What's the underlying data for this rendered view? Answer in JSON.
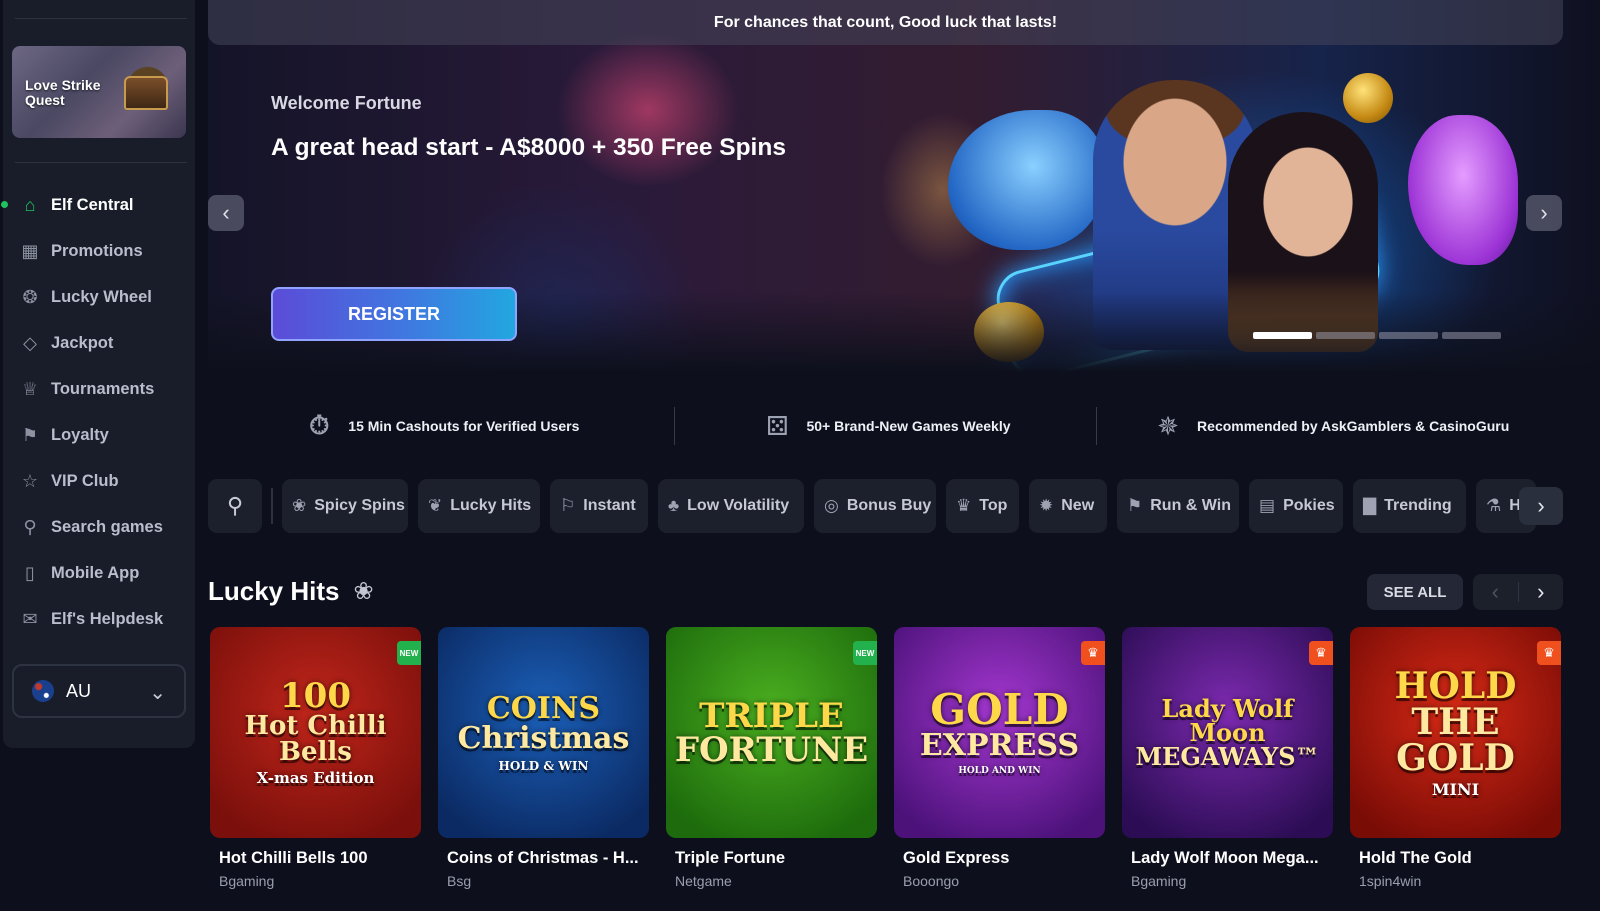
{
  "sidebar": {
    "promo": {
      "title": "Love Strike Quest"
    },
    "nav": [
      {
        "label": "Elf Central",
        "icon": "home-icon",
        "active": true
      },
      {
        "label": "Promotions",
        "icon": "gift-icon"
      },
      {
        "label": "Lucky Wheel",
        "icon": "wheel-icon"
      },
      {
        "label": "Jackpot",
        "icon": "diamond-icon"
      },
      {
        "label": "Tournaments",
        "icon": "trophy-icon"
      },
      {
        "label": "Loyalty",
        "icon": "flag-icon"
      },
      {
        "label": "VIP Club",
        "icon": "star-icon"
      },
      {
        "label": "Search games",
        "icon": "search-icon"
      },
      {
        "label": "Mobile App",
        "icon": "phone-icon"
      },
      {
        "label": "Elf's Helpdesk",
        "icon": "chat-icon"
      }
    ],
    "language": {
      "code": "AU",
      "icon": "australia-flag-icon"
    }
  },
  "hero": {
    "banner": "For chances that count, Good luck that lasts!",
    "subtitle": "Welcome Fortune",
    "title": "A great head start - A$8000 + 350 Free Spins",
    "cta": "REGISTER",
    "slides": 4,
    "active_slide": 1
  },
  "features": [
    {
      "icon": "stopwatch-icon",
      "text": "15 Min Cashouts for Verified Users"
    },
    {
      "icon": "dice-icon",
      "text": "50+ Brand-New Games Weekly"
    },
    {
      "icon": "award-badge-icon",
      "text": "Recommended by AskGamblers & CasinoGuru"
    }
  ],
  "categories": {
    "search_icon": "search-icon",
    "items": [
      {
        "label": "Spicy Spins",
        "icon": "chili-icon"
      },
      {
        "label": "Lucky Hits",
        "icon": "leaf-icon"
      },
      {
        "label": "Instant",
        "icon": "instant-icon"
      },
      {
        "label": "Low Volatility",
        "icon": "clover-icon"
      },
      {
        "label": "Bonus Buy",
        "icon": "coins-icon"
      },
      {
        "label": "Top",
        "icon": "crown-icon"
      },
      {
        "label": "New",
        "icon": "new-badge-icon"
      },
      {
        "label": "Run & Win",
        "icon": "flags-icon"
      },
      {
        "label": "Pokies",
        "icon": "slot-machine-icon"
      },
      {
        "label": "Trending",
        "icon": "chart-icon"
      },
      {
        "label": "H",
        "icon": "potion-icon"
      }
    ]
  },
  "lucky_hits": {
    "title": "Lucky Hits",
    "icon": "leaf-icon",
    "see_all": "SEE ALL",
    "games": [
      {
        "name": "Hot Chilli Bells 100",
        "provider": "Bgaming",
        "badge": "NEW",
        "art": [
          "100",
          "Hot Chilli Bells",
          "X-mas Edition"
        ],
        "bg": [
          "#c0261b",
          "#7a0f0b"
        ]
      },
      {
        "name": "Coins of Christmas - H...",
        "provider": "Bsg",
        "badge": "",
        "art": [
          "COINS",
          "Christmas",
          "HOLD & WIN"
        ],
        "bg": [
          "#1b5fb8",
          "#0b2a63"
        ]
      },
      {
        "name": "Triple Fortune",
        "provider": "Netgame",
        "badge": "NEW",
        "art": [
          "TRIPLE",
          "FORTUNE",
          ""
        ],
        "bg": [
          "#4bb020",
          "#1d6b0c"
        ]
      },
      {
        "name": "Gold Express",
        "provider": "Booongo",
        "badge": "crown",
        "art": [
          "GOLD",
          "EXPRESS",
          "HOLD AND WIN"
        ],
        "bg": [
          "#a437d0",
          "#4c127a"
        ]
      },
      {
        "name": "Lady Wolf Moon Mega...",
        "provider": "Bgaming",
        "badge": "crown",
        "art": [
          "Lady Wolf Moon",
          "MEGAWAYS™",
          ""
        ],
        "bg": [
          "#7d2ab0",
          "#2c0d55"
        ]
      },
      {
        "name": "Hold The Gold",
        "provider": "1spin4win",
        "badge": "crown",
        "art": [
          "HOLD",
          "THE GOLD",
          "MINI"
        ],
        "bg": [
          "#d82a16",
          "#7a0c06"
        ]
      }
    ]
  },
  "colors": {
    "accent_green": "#1fc35c",
    "register_gradient": [
      "#5b4cd8",
      "#22a7e0"
    ],
    "badge_new": "#22b14c",
    "badge_crown": "#f0501e"
  }
}
